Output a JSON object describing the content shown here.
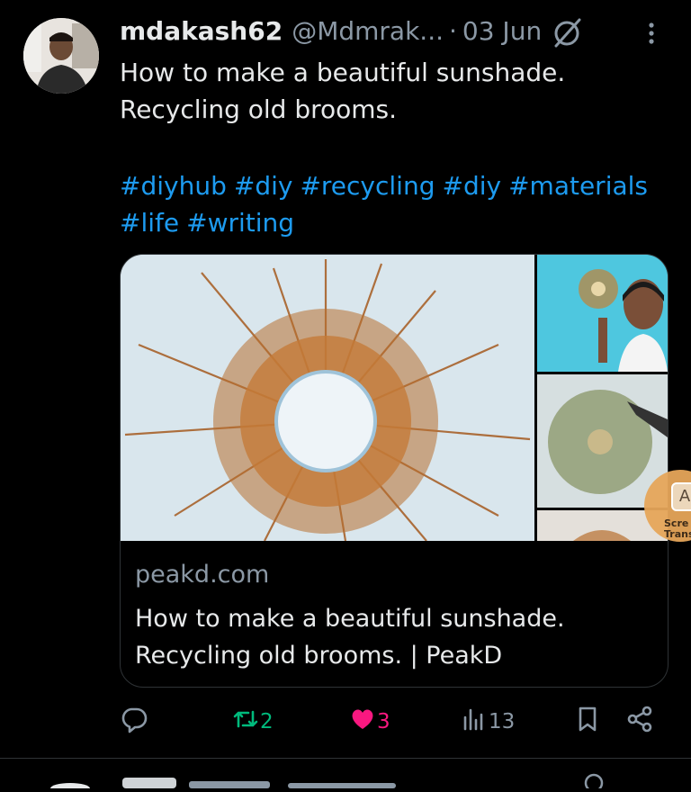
{
  "post": {
    "display_name": "mdakash62",
    "handle": "@Mdmrak...",
    "separator": "·",
    "date": "03 Jun",
    "text_lines": [
      "How to make a beautiful sunshade.",
      "Recycling old brooms."
    ],
    "hashtags": [
      "#diyhub",
      "#diy",
      "#recycling",
      "#diy",
      "#materials",
      "#life",
      "#writing"
    ]
  },
  "card": {
    "domain": "peakd.com",
    "title_lines": [
      "How to make a beautiful sunshade.",
      "Recycling old brooms. | PeakD"
    ]
  },
  "overlay": {
    "letter": "A",
    "text_lines": [
      "Scre",
      "Trans"
    ]
  },
  "actions": {
    "retweets": "2",
    "likes": "3",
    "views": "13",
    "liked": true,
    "retweeted": true
  },
  "colors": {
    "background": "#000000",
    "text": "#e7e9ea",
    "secondary": "#8b98a5",
    "link": "#1d9bf0",
    "retweet": "#00ba7c",
    "like": "#f91880"
  },
  "icons": [
    "grok-icon",
    "more-icon",
    "reply-icon",
    "retweet-icon",
    "heart-icon",
    "views-icon",
    "bookmark-icon",
    "share-icon"
  ]
}
